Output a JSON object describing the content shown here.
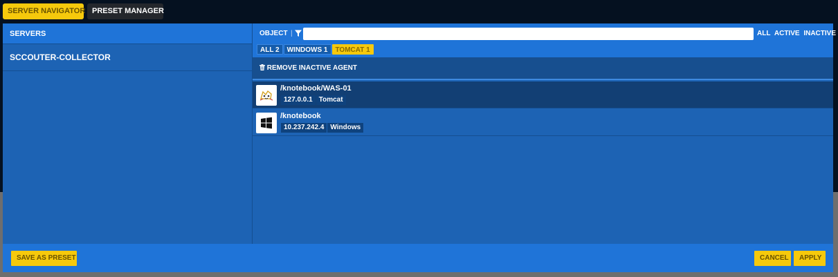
{
  "tabs": {
    "server_navigator": "SERVER NAVIGATOR",
    "preset_manager": "PRESET MANAGER"
  },
  "sidebar": {
    "header": "SERVERS",
    "items": [
      {
        "label": "SCCOUTER-COLLECTOR"
      }
    ]
  },
  "filter_bar": {
    "object_label": "OBJECT",
    "separator": "|",
    "search_value": "",
    "status_filters": [
      "ALL",
      "ACTIVE",
      "INACTIVE"
    ],
    "chips": [
      {
        "label": "ALL 2",
        "active": false
      },
      {
        "label": "WINDOWS 1",
        "active": false
      },
      {
        "label": "TOMCAT 1",
        "active": true
      }
    ]
  },
  "actions": {
    "remove_inactive": "REMOVE INACTIVE AGENT"
  },
  "agents": [
    {
      "name": "/knotebook/WAS-01",
      "ip": "127.0.0.1",
      "type": "Tomcat",
      "icon": "tomcat-icon",
      "selected": true
    },
    {
      "name": "/knotebook",
      "ip": "10.237.242.4",
      "type": "Windows",
      "icon": "windows-icon",
      "selected": false
    }
  ],
  "footer": {
    "save_preset": "SAVE AS PRESET",
    "cancel": "CANCEL",
    "apply": "APPLY"
  },
  "colors": {
    "accent_yellow": "#f6c90c",
    "panel_blue": "#1d63b4",
    "header_blue": "#1f74d8",
    "selected_row": "#123f74",
    "background": "#051120"
  }
}
